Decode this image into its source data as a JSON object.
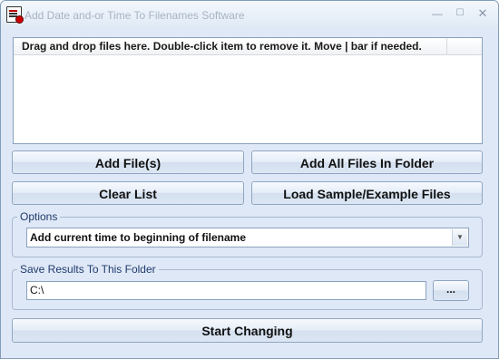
{
  "window": {
    "title": "Add Date and-or Time To Filenames Software",
    "minimize_glyph": "—",
    "maximize_glyph": "☐",
    "close_glyph": "✕",
    "app_icon": "document-calendar-icon"
  },
  "file_list": {
    "header": "Drag and drop files here. Double-click item to remove it. Move | bar if needed."
  },
  "buttons": {
    "add_files": "Add File(s)",
    "add_all_in_folder": "Add All Files In Folder",
    "clear_list": "Clear List",
    "load_sample": "Load Sample/Example Files",
    "start": "Start Changing"
  },
  "options": {
    "label": "Options",
    "selected": "Add current time to beginning of filename"
  },
  "save_folder": {
    "label": "Save Results To This Folder",
    "value": "C:\\",
    "browse_label": "..."
  }
}
